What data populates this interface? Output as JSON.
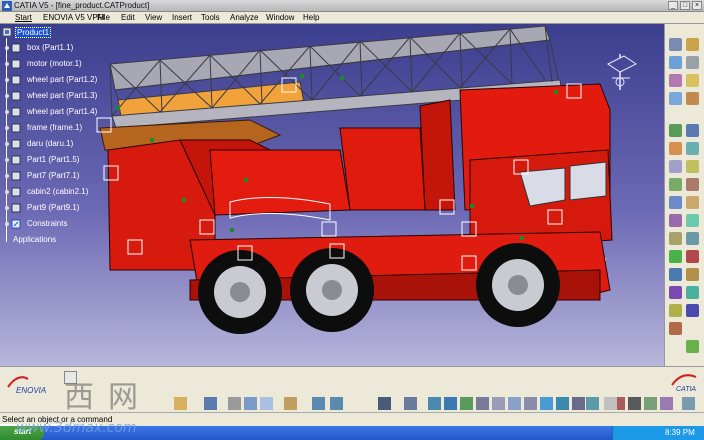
{
  "window": {
    "title": "CATIA V5 - [fine_product.CATProduct]",
    "controls": [
      "_",
      "□",
      "×"
    ]
  },
  "menu": [
    "Start",
    "ENOVIA V5 VPM",
    "File",
    "Edit",
    "View",
    "Insert",
    "Tools",
    "Analyze",
    "Window",
    "Help"
  ],
  "tree": {
    "root": "Product1",
    "items": [
      "box (Part1.1)",
      "motor (motor.1)",
      "wheel part (Part1.2)",
      "wheel part (Part1.3)",
      "wheel part (Part1.4)",
      "frame (frame.1)",
      "daru (daru.1)",
      "Part1 (Part1.5)",
      "Part7 (Part7.1)",
      "cabin2 (cabin2.1)",
      "Part9 (Part9.1)",
      "Constraints",
      "Applications"
    ]
  },
  "status": {
    "prompt": "Select an object or a command",
    "command_value": ""
  },
  "logos": {
    "enovia": "ENOVIA",
    "catia": "CATIA"
  },
  "taskbar": {
    "start": "start",
    "clock": "8:39 PM"
  },
  "watermark": {
    "chinese": "西网",
    "url": "www.3dmax.com"
  },
  "colors": {
    "truck_body": "#e31b0f",
    "ladder": "#b8b8c0",
    "viewport_top": "#3b3e8e",
    "viewport_bottom": "#b8b6da",
    "toolbar": "#ece9d8"
  },
  "icons": {
    "right_toolbar": [
      "select-icon",
      "fit-all-icon",
      "pan-icon",
      "rotate-icon",
      "zoom-in-icon",
      "zoom-out-icon",
      "normal-view-icon",
      "multi-view-icon",
      "iso-view-icon",
      "shading-icon",
      "hide-show-icon",
      "swap-icon",
      "constraint-icon",
      "fix-icon",
      "coincidence-icon",
      "contact-icon",
      "offset-icon",
      "angle-icon",
      "fix-together-icon",
      "quick-constraint-icon",
      "flexible-icon",
      "reuse-pattern-icon",
      "update-icon",
      "existing-component-icon",
      "new-component-icon",
      "new-product-icon",
      "new-part-icon",
      "replace-icon",
      "graph-tree-icon",
      "generate-numbering-icon",
      "selective-load-icon",
      "manage-representations-icon"
    ],
    "bottom_toolbar": [
      "new-icon",
      "open-icon",
      "save-icon",
      "print-icon",
      "cut-icon",
      "copy-icon",
      "paste-icon",
      "undo-icon",
      "redo-icon",
      "whats-this-icon",
      "catalog-icon",
      "measure-icon",
      "measure-item-icon",
      "inertia-icon",
      "fly-icon",
      "fit-all-icon",
      "pan-icon",
      "rotate-icon",
      "zoom-in-icon",
      "zoom-out-icon",
      "normal-view-icon",
      "iso-view-icon",
      "shading-icon",
      "hide-show-icon",
      "swap-icon",
      "formula-icon",
      "sketch-icon",
      "compass-icon"
    ]
  }
}
